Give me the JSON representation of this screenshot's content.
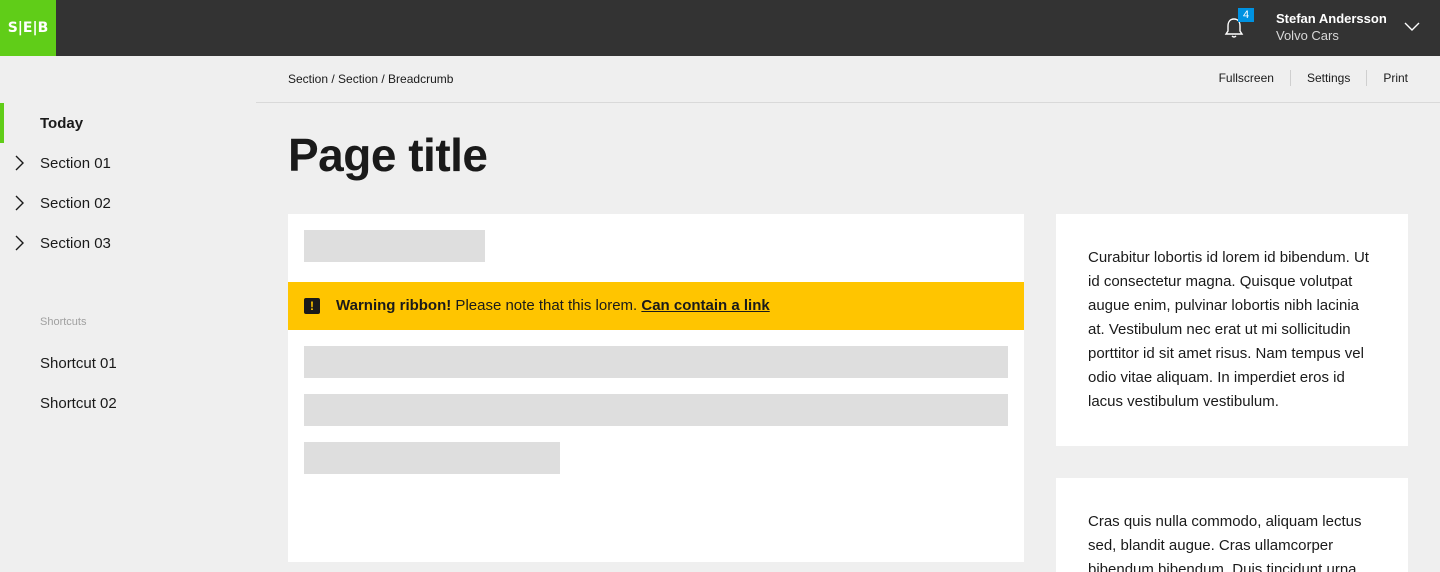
{
  "topbar": {
    "logo_text": "S|E|B",
    "notifications_count": "4",
    "user_name": "Stefan Andersson",
    "user_org": "Volvo Cars",
    "brand_color": "#60cd18",
    "badge_color": "#0092e1"
  },
  "sidebar": {
    "items": [
      {
        "label": "Today",
        "active": true
      },
      {
        "label": "Section 01"
      },
      {
        "label": "Section 02"
      },
      {
        "label": "Section 03"
      }
    ],
    "shortcuts_title": "Shortcuts",
    "shortcuts": [
      {
        "label": "Shortcut 01"
      },
      {
        "label": "Shortcut 02"
      }
    ]
  },
  "header": {
    "breadcrumb": "Section / Section / Breadcrumb",
    "actions": [
      "Fullscreen",
      "Settings",
      "Print"
    ],
    "title": "Page title"
  },
  "warning": {
    "strong": "Warning ribbon!",
    "text": " Please note that this lorem. ",
    "link": "Can contain a link",
    "color": "#ffc500"
  },
  "side_cards": [
    "Curabitur lobortis id lorem id bibendum. Ut id consectetur magna. Quisque volutpat augue enim, pulvinar lobortis nibh lacinia at. Vestibulum nec erat ut mi sollicitudin porttitor id sit amet risus. Nam tempus vel odio vitae aliquam. In imperdiet eros id lacus vestibulum vestibulum.",
    "Cras quis nulla commodo, aliquam lectus sed, blandit augue. Cras ullamcorper bibendum bibendum. Duis tincidunt urna"
  ]
}
